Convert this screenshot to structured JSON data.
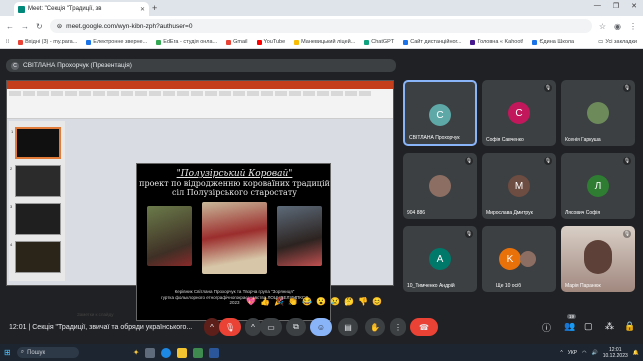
{
  "browser": {
    "tab_title": "Meet: \"Секція \"Традиції, зв",
    "url": "meet.google.com/wyn-kibn-zph?authuser=0",
    "bookmarks": [
      {
        "label": "Вхідні (3) - my.para...",
        "color": "#ea4335"
      },
      {
        "label": "Електронне зверне...",
        "color": "#1a73e8"
      },
      {
        "label": "EdEra - студія онла...",
        "color": "#34a853"
      },
      {
        "label": "Gmail",
        "color": "#ea4335"
      },
      {
        "label": "YouTube",
        "color": "#ff0000"
      },
      {
        "label": "Маневицький ліцей...",
        "color": "#fbbc04"
      },
      {
        "label": "ChatGPT",
        "color": "#10a37f"
      },
      {
        "label": "Сайт дистанційног...",
        "color": "#1a73e8"
      },
      {
        "label": "Головна « Kahoot!",
        "color": "#46178f"
      },
      {
        "label": "Єдина Школа",
        "color": "#1a73e8"
      }
    ],
    "all_bookmarks": "Усі закладки"
  },
  "presenter_label": "СВІТЛАНА Прохорчук (Презентація)",
  "presenter_initial": "C",
  "slide": {
    "title_line1": "\"Полузірський Коровай\"",
    "title_line2": "проект по відродженню короваїних традицій",
    "title_line3": "сіл Полузірського старостату",
    "caption_line1": "Керівник Світлана Прохорчук та Творча група \"Зоряниця\"",
    "caption_line2": "гуртка фольклорного етнографічногокраєзнавства ЛОЦНВЕЛУМПКСЛ",
    "caption_line3": "2023",
    "notes_placeholder": "Заметки к слайду"
  },
  "participants": [
    {
      "name": "СВІТЛАНА Прохорчук",
      "initial": "C",
      "color": "#5fa8a8",
      "active": true,
      "muted": false
    },
    {
      "name": "Софія Савченко",
      "initial": "C",
      "color": "#c2185b",
      "active": false,
      "muted": true
    },
    {
      "name": "Ксенія Гаркуша",
      "initial": "",
      "color": "#6d8a5a",
      "active": false,
      "muted": true
    },
    {
      "name": "904 886",
      "initial": "",
      "color": "#8d6e63",
      "active": false,
      "muted": true
    },
    {
      "name": "Мирослава Дмитрук",
      "initial": "M",
      "color": "#6d4c41",
      "active": false,
      "muted": true
    },
    {
      "name": "Лясович Софія",
      "initial": "Л",
      "color": "#2e7d32",
      "active": false,
      "muted": true
    },
    {
      "name": "10_Тимченко Андрій",
      "initial": "A",
      "color": "#00796b",
      "active": false,
      "muted": true
    },
    {
      "name": "Ще 10 осіб",
      "initial": "K",
      "color": "#e8710a",
      "active": false,
      "muted": false
    },
    {
      "name": "Марія Паранюк",
      "initial": "",
      "color": "#a1887f",
      "active": false,
      "muted": true
    }
  ],
  "reactions": [
    "💖",
    "👍",
    "🎉",
    "👏",
    "😂",
    "😮",
    "😢",
    "🤔",
    "👎",
    "😊"
  ],
  "meeting": {
    "time": "12:01",
    "title": "Секція \"Традиції, звичаї та обряди українського...",
    "participants_count": "19"
  },
  "taskbar": {
    "search_label": "Пошук",
    "lang": "УКР",
    "clock_time": "12:01",
    "clock_date": "10.12.2023"
  },
  "colors": {
    "meet_bg": "#202124",
    "control_bg": "#3c4043",
    "end_call": "#ea4335",
    "accent": "#8ab4f8"
  }
}
